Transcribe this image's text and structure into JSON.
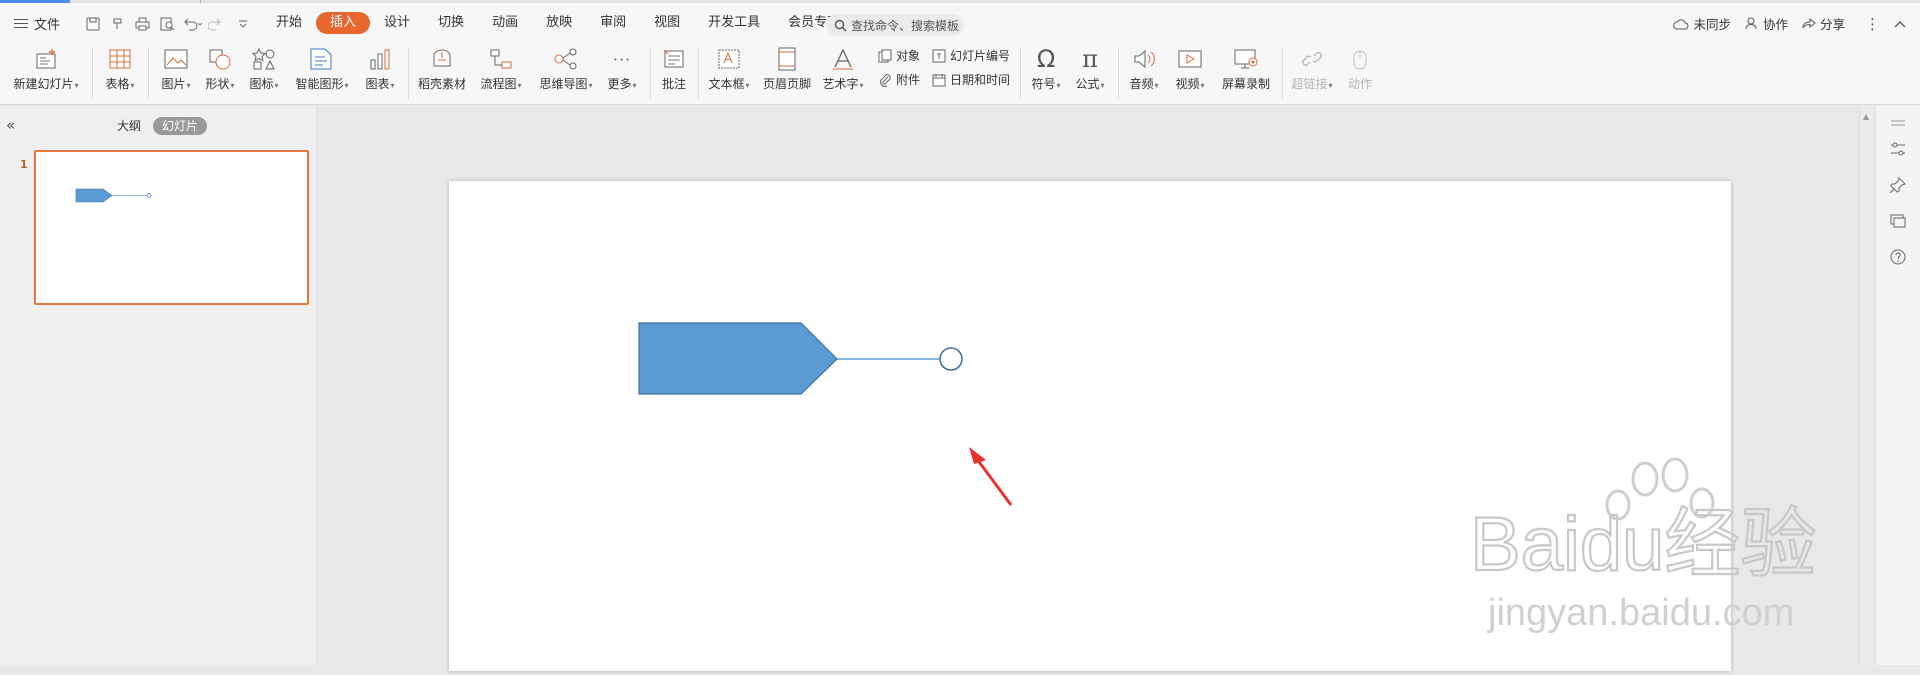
{
  "menu": {
    "file_label": "文件"
  },
  "tabs": [
    {
      "label": "开始"
    },
    {
      "label": "插入"
    },
    {
      "label": "设计"
    },
    {
      "label": "切换"
    },
    {
      "label": "动画"
    },
    {
      "label": "放映"
    },
    {
      "label": "审阅"
    },
    {
      "label": "视图"
    },
    {
      "label": "开发工具"
    },
    {
      "label": "会员专享"
    }
  ],
  "active_tab": "插入",
  "search": {
    "placeholder": "查找命令、搜索模板"
  },
  "top_actions": {
    "sync": "未同步",
    "collab": "协作",
    "share": "分享"
  },
  "ribbon": {
    "new_slide": "新建幻灯片",
    "table": "表格",
    "picture": "图片",
    "shape": "形状",
    "icon": "图标",
    "smartart": "智能图形",
    "chart": "图表",
    "docer": "稻壳素材",
    "flowchart": "流程图",
    "mindmap": "思维导图",
    "more": "更多",
    "comment": "批注",
    "textbox": "文本框",
    "header_footer": "页眉页脚",
    "wordart": "艺术字",
    "object": "对象",
    "slide_number": "幻灯片编号",
    "attachment": "附件",
    "datetime": "日期和时间",
    "symbol": "符号",
    "formula": "公式",
    "audio": "音频",
    "video": "视频",
    "screen_record": "屏幕录制",
    "hyperlink": "超链接",
    "action": "动作"
  },
  "panel": {
    "outline_tab": "大纲",
    "slides_tab": "幻灯片",
    "slide_number": "1"
  },
  "watermark": {
    "brand": "Baidu经验",
    "url": "jingyan.baidu.com"
  },
  "colors": {
    "accent": "#e8672f",
    "shape_fill": "#5b9bd5",
    "shape_stroke": "#41719c",
    "arrow": "#e8312f"
  }
}
